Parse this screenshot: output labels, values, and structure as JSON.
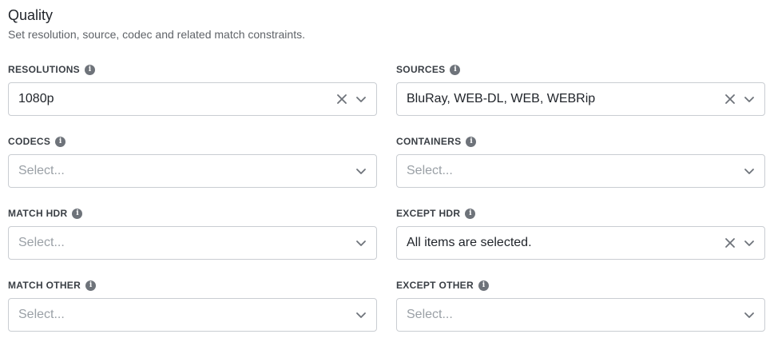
{
  "section": {
    "title": "Quality",
    "subtitle": "Set resolution, source, codec and related match constraints."
  },
  "fields": {
    "resolutions": {
      "label": "RESOLUTIONS",
      "value": "1080p"
    },
    "sources": {
      "label": "SOURCES",
      "value": "BluRay, WEB-DL, WEB, WEBRip"
    },
    "codecs": {
      "label": "CODECS",
      "placeholder": "Select..."
    },
    "containers": {
      "label": "CONTAINERS",
      "placeholder": "Select..."
    },
    "match_hdr": {
      "label": "MATCH HDR",
      "placeholder": "Select..."
    },
    "except_hdr": {
      "label": "EXCEPT HDR",
      "value": "All items are selected."
    },
    "match_other": {
      "label": "MATCH OTHER",
      "placeholder": "Select..."
    },
    "except_other": {
      "label": "EXCEPT OTHER",
      "placeholder": "Select..."
    }
  },
  "icons": {
    "info": "info-icon",
    "clear": "clear-icon",
    "dropdown": "chevron-down-icon"
  },
  "colors": {
    "border": "#c9cdd2",
    "placeholder": "#9aa0a6",
    "icon": "#6e737a",
    "text": "#1f2329"
  }
}
